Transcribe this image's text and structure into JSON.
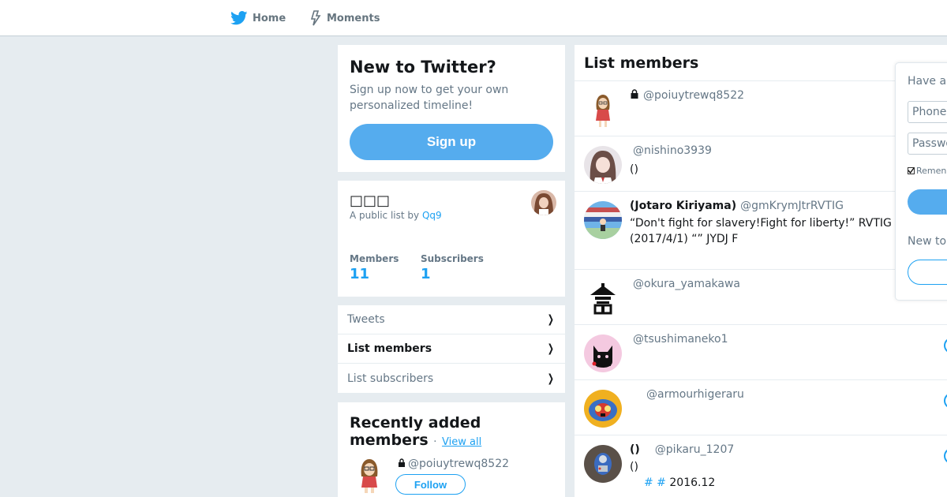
{
  "nav": {
    "home_label": "Home",
    "moments_label": "Moments",
    "home_icon": "twitter-bird-icon",
    "moments_icon": "lightning-icon"
  },
  "signup_card": {
    "title": "New to Twitter?",
    "subtitle": "Sign up now to get your own personalized timeline!",
    "button_label": "Sign up"
  },
  "list_info": {
    "name": "□□□",
    "byline_prefix": "A public list by",
    "owner": "Qq9",
    "members_label": "Members",
    "members_count": "11",
    "subscribers_label": "Subscribers",
    "subscribers_count": "1"
  },
  "list_links": [
    {
      "label": "Tweets",
      "active": false
    },
    {
      "label": "List members",
      "active": true
    },
    {
      "label": "List subscribers",
      "active": false
    }
  ],
  "recent": {
    "title": "Recently added members",
    "separator": "·",
    "view_all": "View all",
    "handle": "@poiuytrewq8522",
    "follow_label": "Follow"
  },
  "members": {
    "header": "List members",
    "items": [
      {
        "name": "",
        "handle": "@poiuytrewq8522",
        "protected": true,
        "bio": ""
      },
      {
        "name": "",
        "handle": "@nishino3939",
        "protected": false,
        "bio": "()"
      },
      {
        "name": "(Jotaro Kiriyama)",
        "handle": "@gmKrymJtrRVTIG",
        "protected": false,
        "bio": "“Don't fight for slavery!Fight for liberty!” RVTIG (2017/4/1) “” JYDJ F"
      },
      {
        "name": "",
        "handle": "@okura_yamakawa",
        "protected": false,
        "bio": ""
      },
      {
        "name": "",
        "handle": "@tsushimaneko1",
        "protected": false,
        "bio": ""
      },
      {
        "name": "",
        "handle": "@armourhigeraru",
        "protected": false,
        "bio": ""
      },
      {
        "name": "()",
        "handle": "@pikaru_1207",
        "protected": false,
        "bio": "()",
        "bio2_tags": "# #",
        "bio2_text": "2016.12"
      }
    ]
  },
  "login": {
    "title": "Have ar",
    "phone_placeholder": "Phone,",
    "password_placeholder": "Passwo",
    "remember_label": "Remen",
    "new_to": "New to"
  },
  "colors": {
    "accent": "#1da1f2",
    "button": "#55acee",
    "background": "#e6ecf0"
  }
}
